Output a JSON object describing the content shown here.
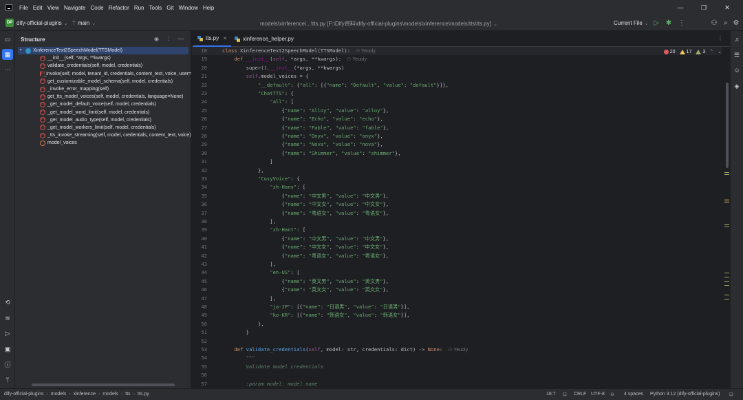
{
  "menu": [
    "File",
    "Edit",
    "View",
    "Navigate",
    "Code",
    "Refactor",
    "Run",
    "Tools",
    "Git",
    "Window",
    "Help"
  ],
  "toolbar": {
    "project_badge": "DP",
    "project_name": "dify-official-plugins",
    "branch": "main",
    "title_path": "models\\xinference\\...\\tts.py [F:\\Dify资料\\dify-official-plugins\\models\\xinference\\models\\tts\\tts.py]",
    "run_config": "Current File"
  },
  "structure": {
    "title": "Structure",
    "items": [
      {
        "label": "XinferenceText2SpeechModel(TTSModel)",
        "kind": "class",
        "selected": true
      },
      {
        "label": "__init__(self, *args, **kwargs)",
        "kind": "method"
      },
      {
        "label": "validate_credentials(self, model, credentials)",
        "kind": "method"
      },
      {
        "label": "_invoke(self, model, tenant_id, credentials, content_text, voice, user=",
        "kind": "method"
      },
      {
        "label": "get_customizable_model_schema(self, model, credentials)",
        "kind": "method"
      },
      {
        "label": "_invoke_error_mapping(self)",
        "kind": "method"
      },
      {
        "label": "get_tts_model_voices(self, model, credentials, language=None)",
        "kind": "method"
      },
      {
        "label": "_get_model_default_voice(self, model, credentials)",
        "kind": "method"
      },
      {
        "label": "_get_model_word_limit(self, model, credentials)",
        "kind": "method"
      },
      {
        "label": "_get_model_audio_type(self, model, credentials)",
        "kind": "method"
      },
      {
        "label": "_get_model_workers_limit(self, model, credentials)",
        "kind": "method"
      },
      {
        "label": "_tts_invoke_streaming(self, model, credentials, content_text, voice)",
        "kind": "method"
      },
      {
        "label": "model_voices",
        "kind": "field"
      }
    ]
  },
  "tabs": [
    {
      "label": "tts.py",
      "active": true
    },
    {
      "label": "xinference_helper.py",
      "active": false
    }
  ],
  "inspections": {
    "errors": "20",
    "warnings": "17",
    "weak": "3"
  },
  "author": "Yeuoly",
  "code_lines": [
    {
      "n": "18",
      "t": "class XinferenceText2SpeechModel(TTSModel):"
    },
    {
      "n": "19",
      "t": "    def __init__(self, *args, **kwargs):"
    },
    {
      "n": "20",
      "t": "        super().__init__(*args, **kwargs)"
    },
    {
      "n": "21",
      "t": "        self.model_voices = {"
    },
    {
      "n": "22",
      "t": "            \"__default\": {\"all\": [{\"name\": \"Default\", \"value\": \"default\"}]},"
    },
    {
      "n": "23",
      "t": "            \"ChatTTS\": {"
    },
    {
      "n": "24",
      "t": "                \"all\": ["
    },
    {
      "n": "25",
      "t": "                    {\"name\": \"Alloy\", \"value\": \"alloy\"},"
    },
    {
      "n": "26",
      "t": "                    {\"name\": \"Echo\", \"value\": \"echo\"},"
    },
    {
      "n": "27",
      "t": "                    {\"name\": \"Fable\", \"value\": \"fable\"},"
    },
    {
      "n": "28",
      "t": "                    {\"name\": \"Onyx\", \"value\": \"onyx\"},"
    },
    {
      "n": "29",
      "t": "                    {\"name\": \"Nova\", \"value\": \"nova\"},"
    },
    {
      "n": "30",
      "t": "                    {\"name\": \"Shimmer\", \"value\": \"shimmer\"},"
    },
    {
      "n": "31",
      "t": "                ]"
    },
    {
      "n": "32",
      "t": "            },"
    },
    {
      "n": "33",
      "t": "            \"CosyVoice\": {"
    },
    {
      "n": "34",
      "t": "                \"zh-Hans\": ["
    },
    {
      "n": "35",
      "t": "                    {\"name\": \"中文男\", \"value\": \"中文男\"},"
    },
    {
      "n": "36",
      "t": "                    {\"name\": \"中文女\", \"value\": \"中文女\"},"
    },
    {
      "n": "37",
      "t": "                    {\"name\": \"粤语女\", \"value\": \"粤语女\"},"
    },
    {
      "n": "38",
      "t": "                ],"
    },
    {
      "n": "39",
      "t": "                \"zh-Hant\": ["
    },
    {
      "n": "40",
      "t": "                    {\"name\": \"中文男\", \"value\": \"中文男\"},"
    },
    {
      "n": "41",
      "t": "                    {\"name\": \"中文女\", \"value\": \"中文女\"},"
    },
    {
      "n": "42",
      "t": "                    {\"name\": \"粤语女\", \"value\": \"粤语女\"},"
    },
    {
      "n": "43",
      "t": "                ],"
    },
    {
      "n": "44",
      "t": "                \"en-US\": ["
    },
    {
      "n": "45",
      "t": "                    {\"name\": \"英文男\", \"value\": \"英文男\"},"
    },
    {
      "n": "46",
      "t": "                    {\"name\": \"英文女\", \"value\": \"英文女\"},"
    },
    {
      "n": "47",
      "t": "                ],"
    },
    {
      "n": "48",
      "t": "                \"ja-JP\": [{\"name\": \"日语男\", \"value\": \"日语男\"}],"
    },
    {
      "n": "49",
      "t": "                \"ko-KR\": [{\"name\": \"韩语女\", \"value\": \"韩语女\"}],"
    },
    {
      "n": "50",
      "t": "            },"
    },
    {
      "n": "51",
      "t": "        }"
    },
    {
      "n": "52",
      "t": ""
    },
    {
      "n": "53",
      "t": "    def validate_credentials(self, model: str, credentials: dict) -> None:"
    },
    {
      "n": "54",
      "t": "        \"\"\""
    },
    {
      "n": "55",
      "t": "        Validate model credentials"
    },
    {
      "n": "56",
      "t": ""
    },
    {
      "n": "57",
      "t": "        :param model: model name"
    }
  ],
  "status": {
    "breadcrumb": [
      "dify-official-plugins",
      "models",
      "xinference",
      "models",
      "tts",
      "tts.py"
    ],
    "position": "18:7",
    "line_sep": "CRLF",
    "encoding": "UTF-8",
    "indent": "4 spaces",
    "interpreter": "Python 3.12 (dify-official-plugins)"
  },
  "colors": {
    "accent": "#3574f0",
    "keyword": "#cf8e6d",
    "string": "#6aab73",
    "function": "#56a8f5"
  }
}
